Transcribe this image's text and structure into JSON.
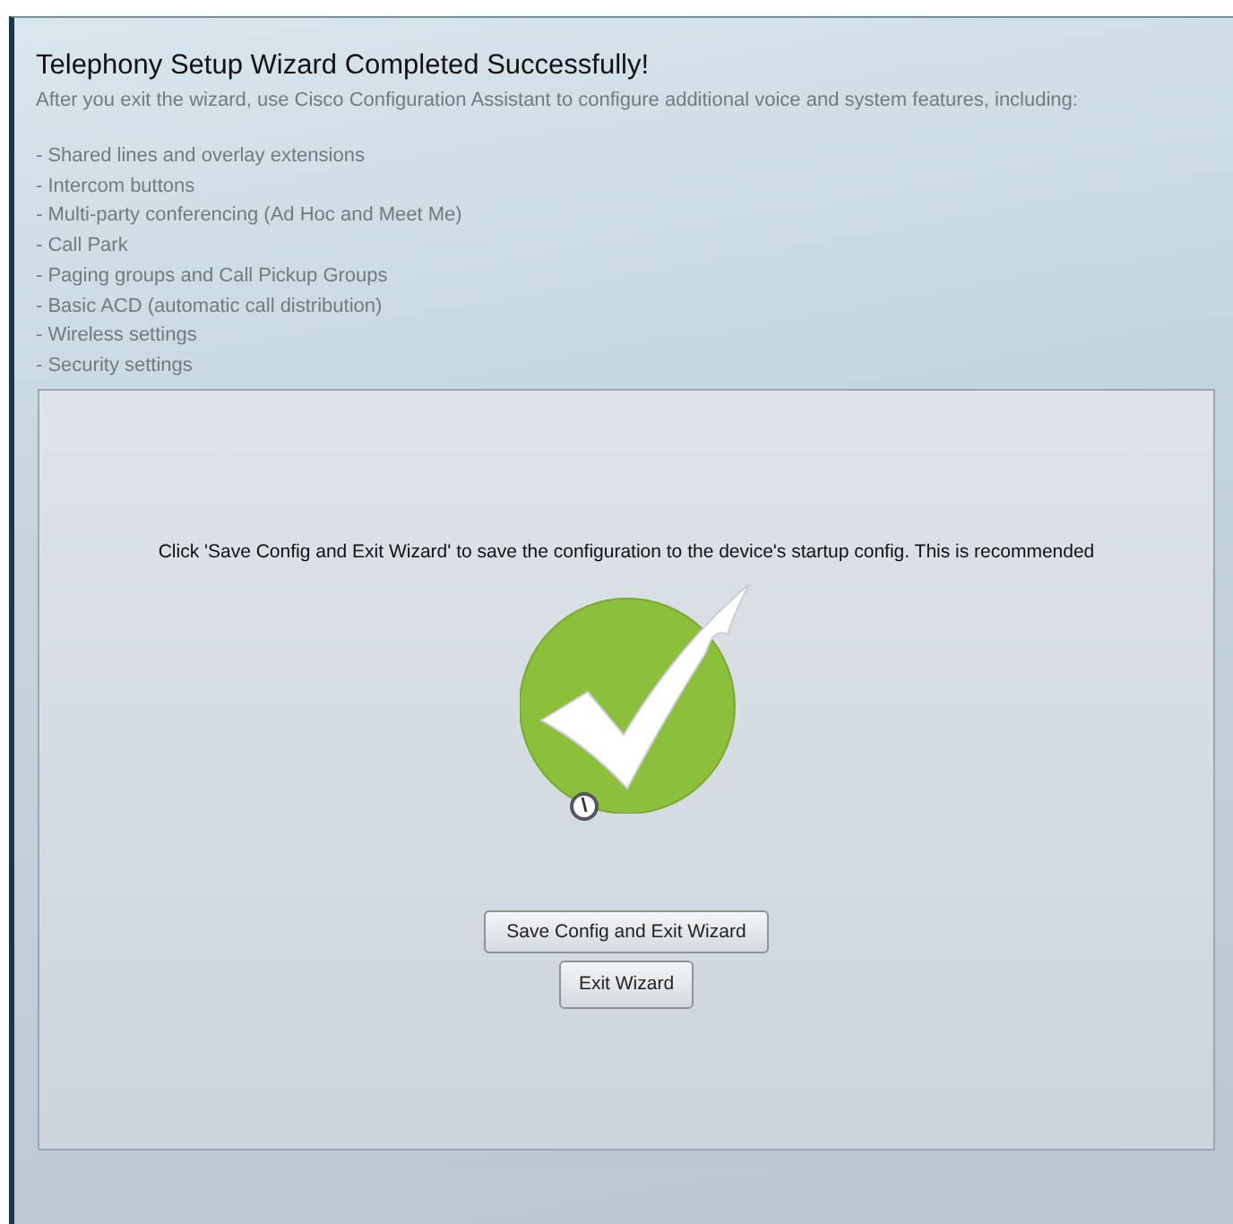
{
  "title": "Telephony Setup Wizard Completed Successfully!",
  "intro": "After you exit the wizard, use Cisco Configuration Assistant to configure additional voice and system features, including:",
  "features": [
    "- Shared lines and overlay extensions",
    "- Intercom buttons",
    "- Multi-party conferencing (Ad Hoc and Meet Me)",
    "- Call Park",
    "- Paging groups and Call Pickup Groups",
    "- Basic ACD (automatic call distribution)",
    "- Wireless settings",
    "- Security settings"
  ],
  "panel": {
    "message": "Click 'Save Config and Exit Wizard' to save the configuration to the device's startup config.  This is recommended",
    "buttons": [
      "Save Config and Exit Wizard",
      "Exit Wizard"
    ]
  }
}
